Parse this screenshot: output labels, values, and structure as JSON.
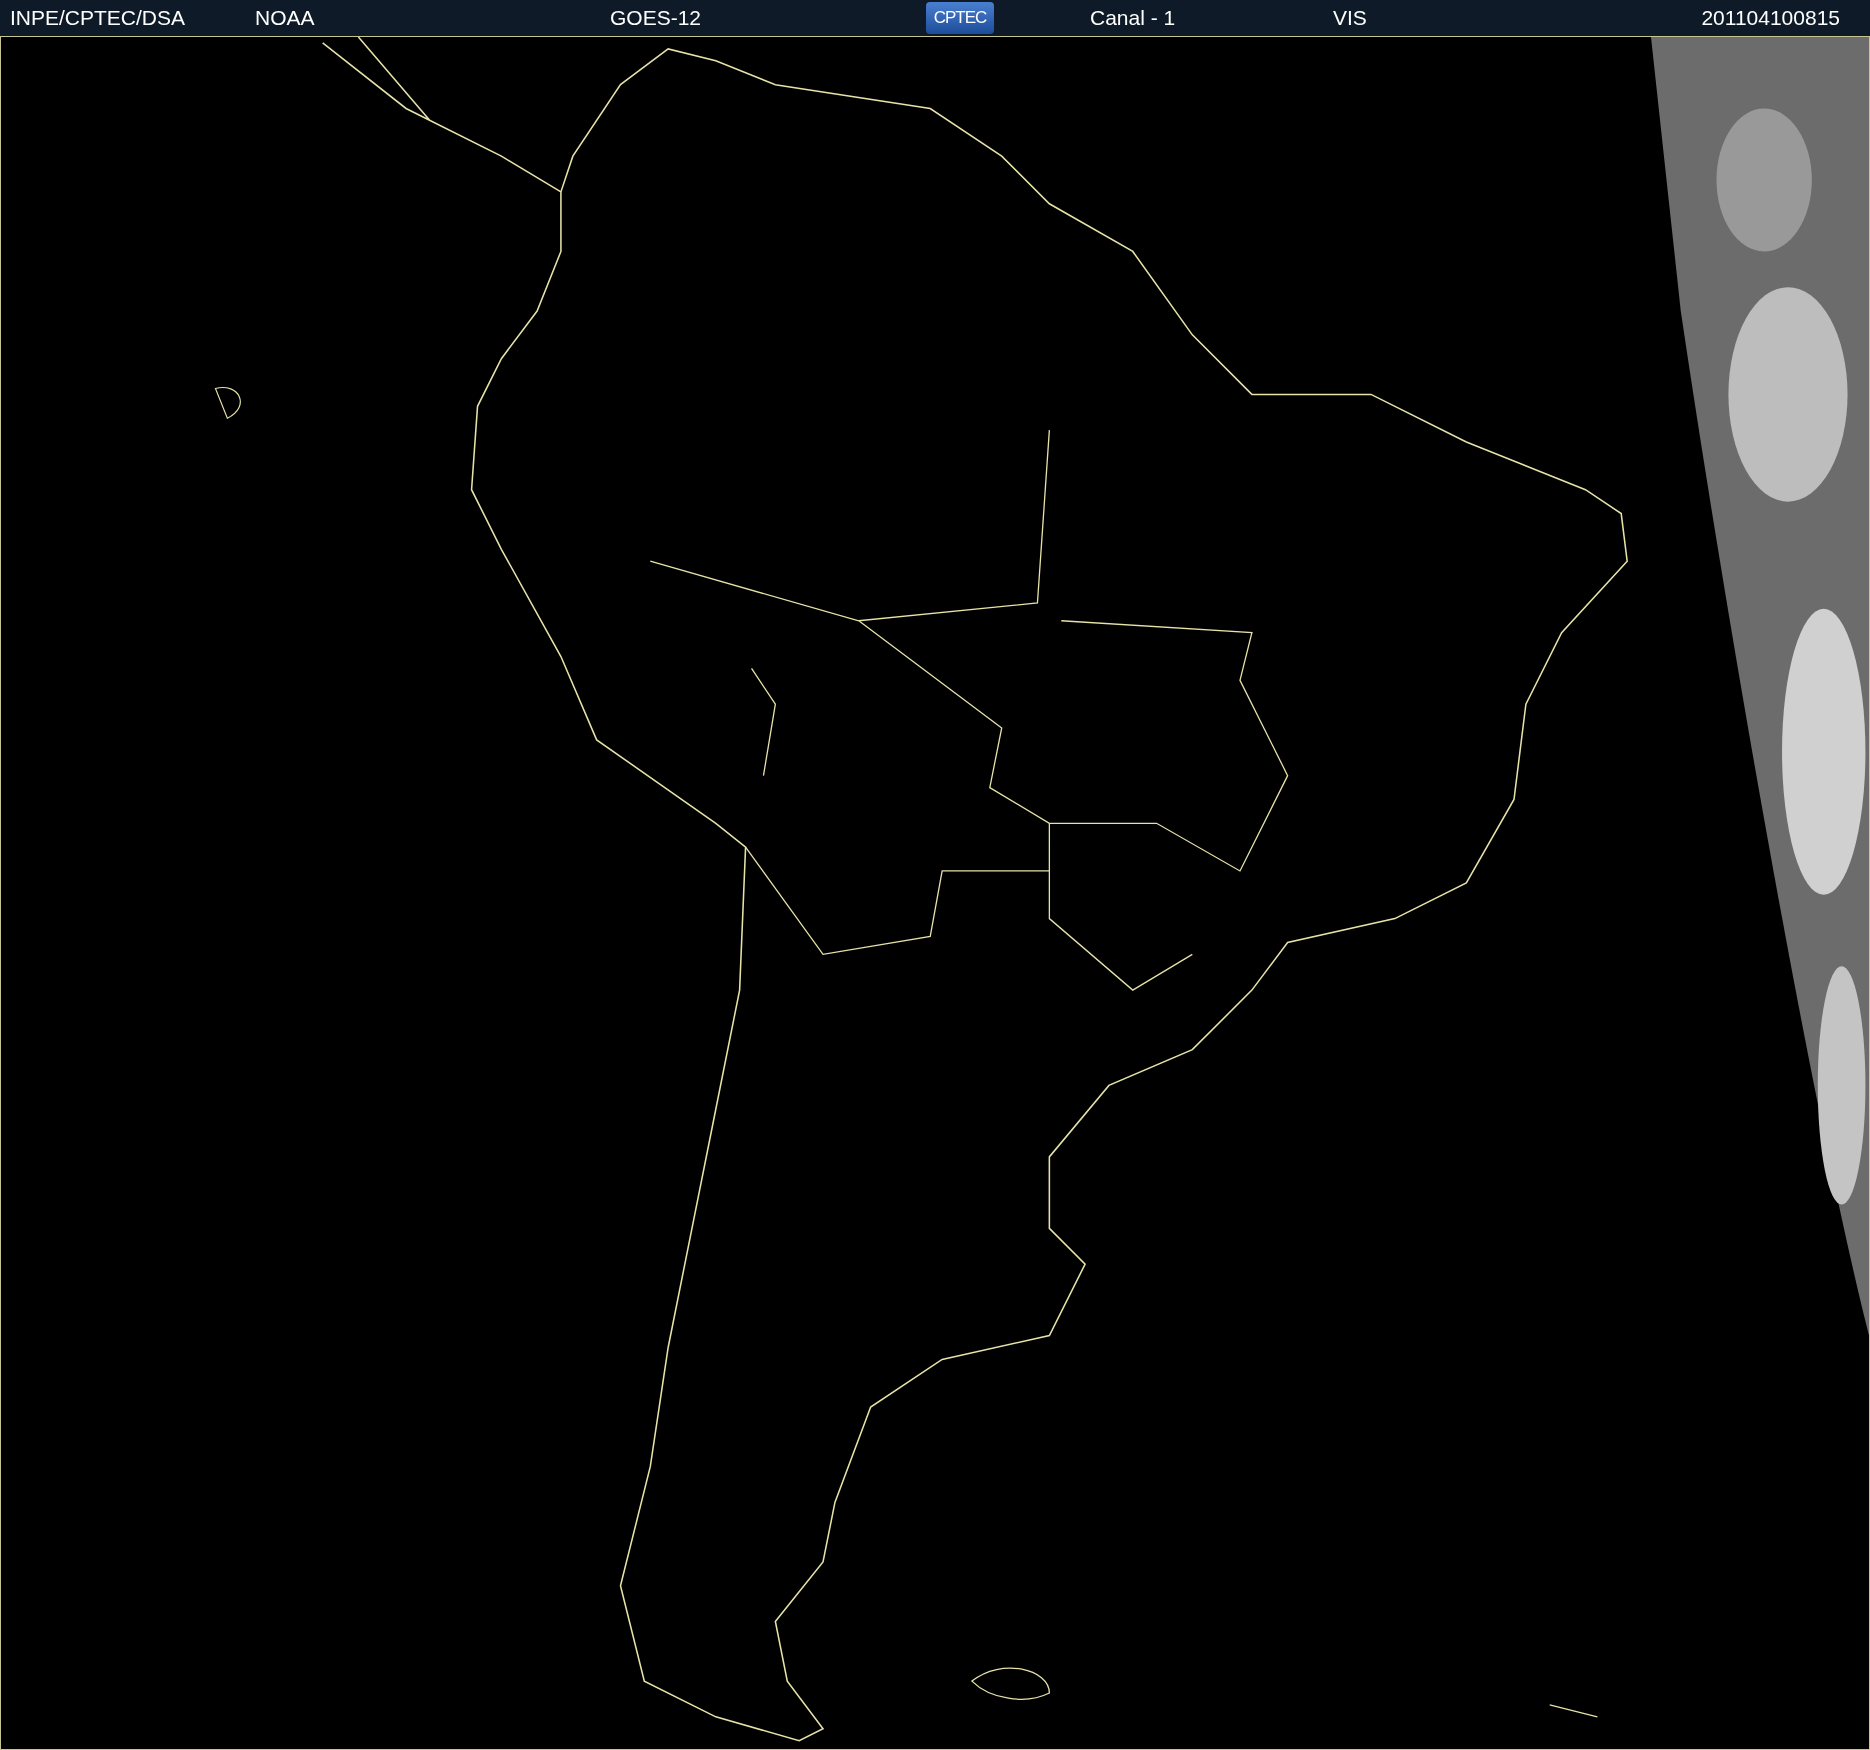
{
  "header": {
    "source": "INPE/CPTEC/DSA",
    "agency": "NOAA",
    "satellite": "GOES-12",
    "logo": "CPTEC",
    "channel": "Canal - 1",
    "band": "VIS",
    "timestamp": "201104100815"
  }
}
